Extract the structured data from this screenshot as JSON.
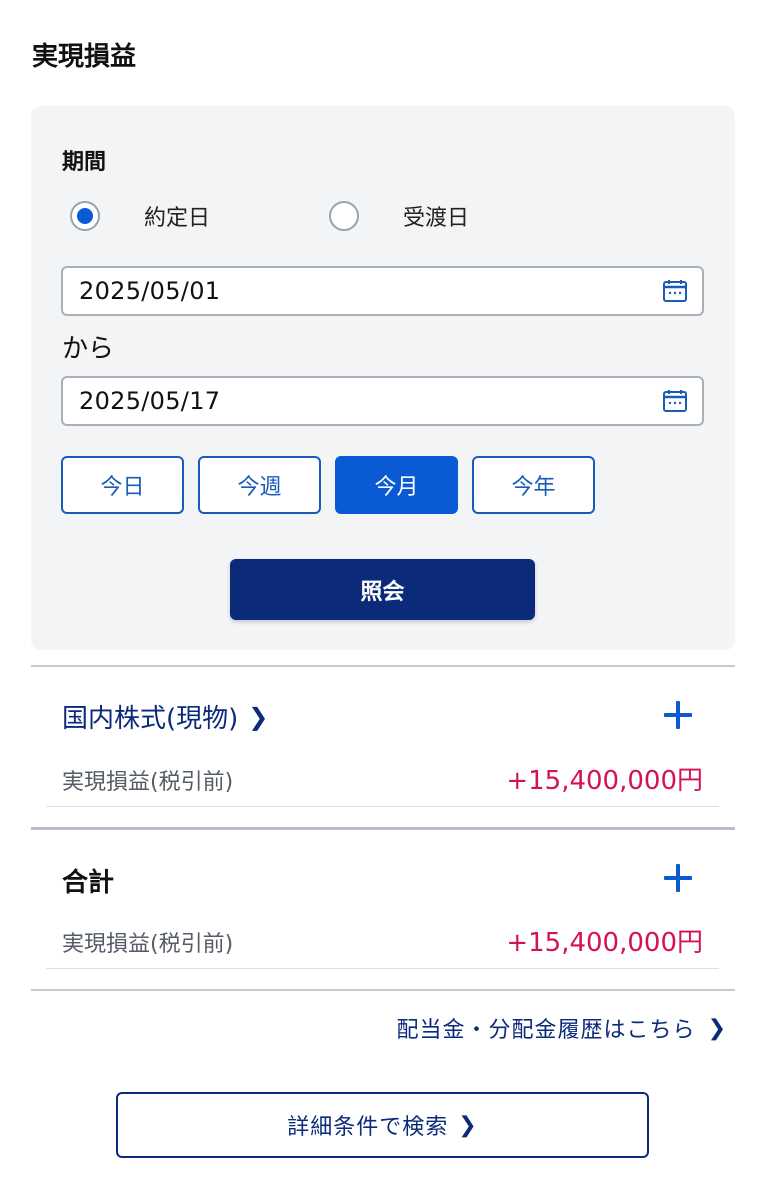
{
  "page": {
    "title": "実現損益"
  },
  "filter": {
    "period_label": "期間",
    "radios": [
      {
        "label": "約定日",
        "checked": true
      },
      {
        "label": "受渡日",
        "checked": false
      }
    ],
    "date_from": "2025/05/01",
    "from_suffix": "から",
    "date_to": "2025/05/17",
    "quick_buttons": [
      {
        "label": "今日",
        "active": false
      },
      {
        "label": "今週",
        "active": false
      },
      {
        "label": "今月",
        "active": true
      },
      {
        "label": "今年",
        "active": false
      }
    ],
    "search_label": "照会"
  },
  "sections": [
    {
      "title": "国内株式(現物)",
      "row_label": "実現損益(税引前)",
      "row_value": "+15,400,000円"
    },
    {
      "title": "合計",
      "row_label": "実現損益(税引前)",
      "row_value": "+15,400,000円"
    }
  ],
  "links": {
    "dividend": "配当金・分配金履歴はこちら",
    "advanced_search": "詳細条件で検索"
  },
  "icons": {
    "date_picker": "calendar-icon",
    "chevron": "chevron-right-icon",
    "expand": "plus-icon"
  },
  "colors": {
    "primary": "#0b2a7a",
    "accent": "#0a5ad4",
    "profit": "#d4134f",
    "panel_bg": "#f3f4f6"
  }
}
